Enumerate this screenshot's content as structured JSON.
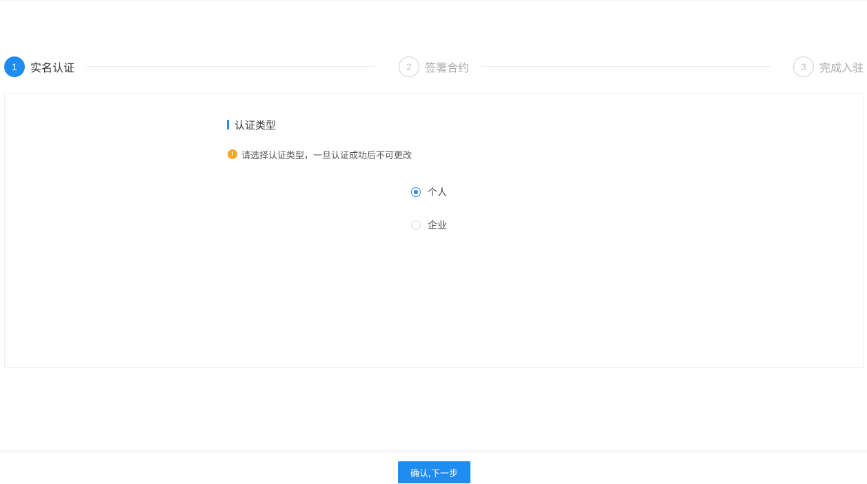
{
  "steps": [
    {
      "number": "1",
      "label": "实名认证",
      "state": "active"
    },
    {
      "number": "2",
      "label": "签署合约",
      "state": "pending"
    },
    {
      "number": "3",
      "label": "完成入驻",
      "state": "pending"
    }
  ],
  "form": {
    "section_title": "认证类型",
    "warning_icon": "exclamation-circle-icon",
    "warning_icon_glyph": "!",
    "warning_text": "请选择认证类型，一旦认证成功后不可更改",
    "options": [
      {
        "label": "个人",
        "checked": true
      },
      {
        "label": "企业",
        "checked": false
      }
    ]
  },
  "footer": {
    "confirm_label": "确认,下一步"
  },
  "colors": {
    "accent": "#1e8cf0",
    "warning": "#f5a623"
  }
}
